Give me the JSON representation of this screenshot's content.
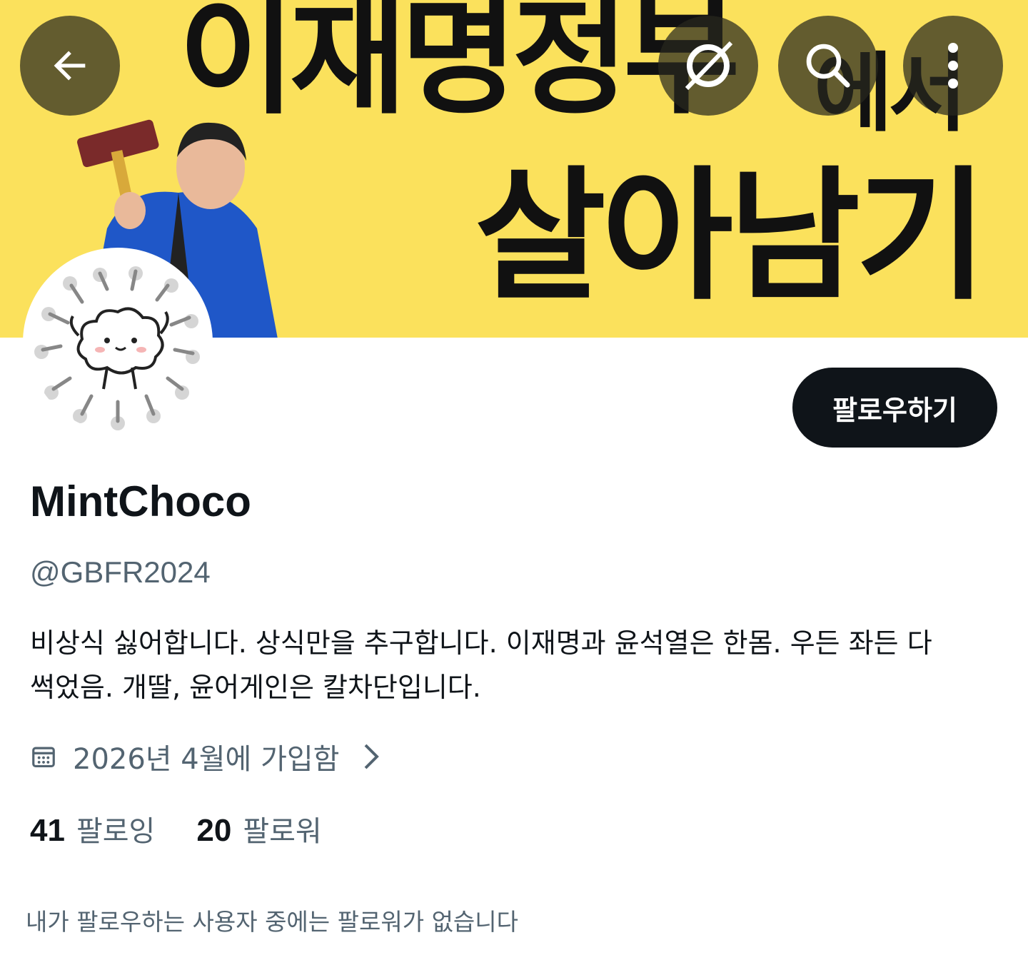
{
  "banner": {
    "line1": "이재명정부",
    "line1_small": "에서",
    "line2": "살아남기",
    "background": "#fbe15c"
  },
  "nav": {
    "back_icon": "arrow-left-icon",
    "grok_icon": "grok-icon",
    "search_icon": "search-icon",
    "more_icon": "more-vertical-icon"
  },
  "profile": {
    "follow_label": "팔로우하기",
    "display_name": "MintChoco",
    "handle": "@GBFR2024",
    "bio_line1": "비상식 싫어합니다. 상식만을 추구합니다. 이재명과 윤석열은 한몸. 우든 좌든 다",
    "bio_line2": "썩었음. 개딸, 윤어게인은 칼차단입니다.",
    "joined": "2026년 4월에 가입함"
  },
  "stats": {
    "following_count": "41",
    "following_label": "팔로잉",
    "followers_count": "20",
    "followers_label": "팔로워"
  },
  "note": "내가 팔로우하는 사용자 중에는 팔로워가 없습니다",
  "colors": {
    "primary_text": "#0f1419",
    "secondary_text": "#536471",
    "follow_button": "#0f1419"
  }
}
